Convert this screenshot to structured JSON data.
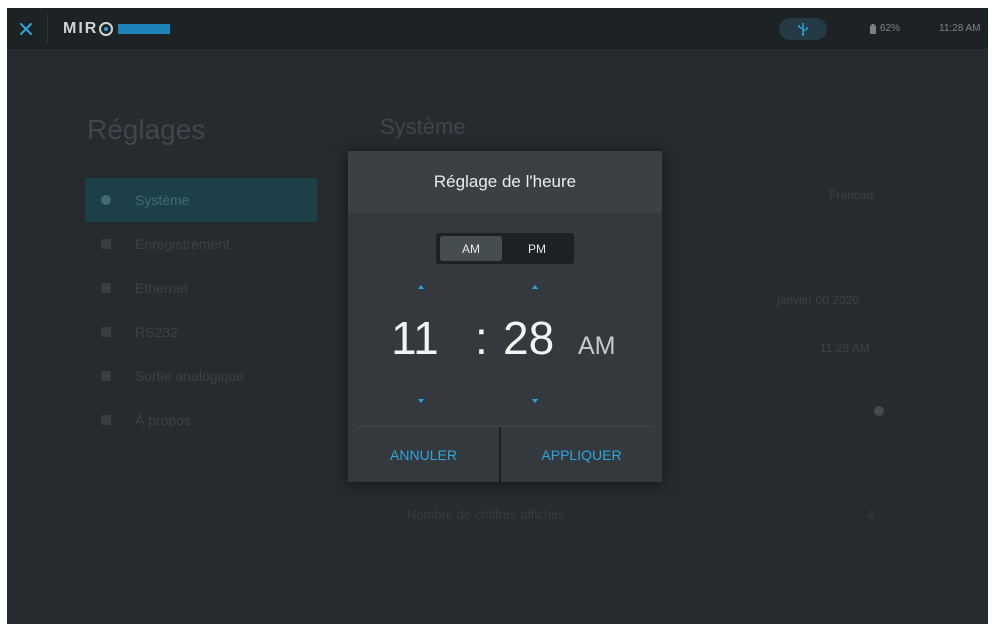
{
  "topbar": {
    "logo_text": "MIR",
    "logo_badge": "",
    "battery": "62%",
    "clock": "11:28 AM"
  },
  "background": {
    "breadcrumb": "",
    "settings_title": "Réglages",
    "system_title": "Système",
    "nav_items": [
      {
        "label": "Système"
      },
      {
        "label": "Enregistrement"
      },
      {
        "label": "Ethernet"
      },
      {
        "label": "RS232"
      },
      {
        "label": "Sortie analogique"
      },
      {
        "label": "À propos"
      }
    ],
    "language_value": "Français",
    "date_value": "janvier 00 2020",
    "time_value": "11:28 AM",
    "digits_label": "Nombre de chiffres affichés",
    "digits_value": "4",
    "bottom_text": ""
  },
  "dialog": {
    "title": "Réglage de l'heure",
    "am_label": "AM",
    "pm_label": "PM",
    "hour": "11",
    "separator": ":",
    "minute": "28",
    "period": "AM",
    "cancel_label": "ANNULER",
    "apply_label": "APPLIQUER"
  },
  "colors": {
    "accent": "#2ea6de",
    "background": "#252b2e",
    "dialog": "#33393c"
  }
}
